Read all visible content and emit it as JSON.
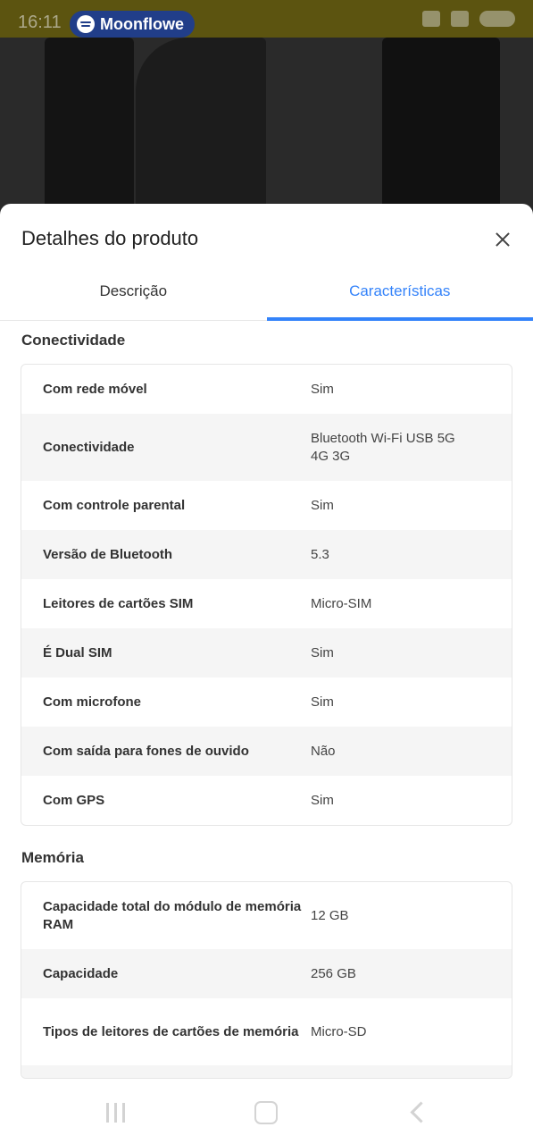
{
  "status_bar": {
    "time": "16:11",
    "spotify_label": "Moonflowe"
  },
  "sheet": {
    "title": "Detalhes do produto"
  },
  "tabs": [
    {
      "label": "Descrição",
      "active": false
    },
    {
      "label": "Características",
      "active": true
    }
  ],
  "sections": [
    {
      "title": "Conectividade",
      "rows": [
        {
          "key": "Com rede móvel",
          "value": "Sim"
        },
        {
          "key": "Conectividade",
          "value": "Bluetooth Wi-Fi USB 5G 4G 3G"
        },
        {
          "key": "Com controle parental",
          "value": "Sim"
        },
        {
          "key": "Versão de Bluetooth",
          "value": "5.3"
        },
        {
          "key": "Leitores de cartões SIM",
          "value": "Micro-SIM"
        },
        {
          "key": "É Dual SIM",
          "value": "Sim"
        },
        {
          "key": "Com microfone",
          "value": "Sim"
        },
        {
          "key": "Com saída para fones de ouvido",
          "value": "Não"
        },
        {
          "key": "Com GPS",
          "value": "Sim"
        }
      ]
    },
    {
      "title": "Memória",
      "rows": [
        {
          "key": "Capacidade total do módulo de memória RAM",
          "value": "12 GB"
        },
        {
          "key": "Capacidade",
          "value": "256 GB"
        },
        {
          "key": "Tipos de leitores de cartões de memória",
          "value": "Micro-SD"
        }
      ]
    }
  ],
  "colors": {
    "accent": "#3483fa",
    "spotify_pill": "#213e89"
  },
  "icons": {
    "close": "close-icon",
    "spotify": "spotify-icon",
    "nav_recents": "recents-icon",
    "nav_home": "home-icon",
    "nav_back": "back-icon"
  }
}
